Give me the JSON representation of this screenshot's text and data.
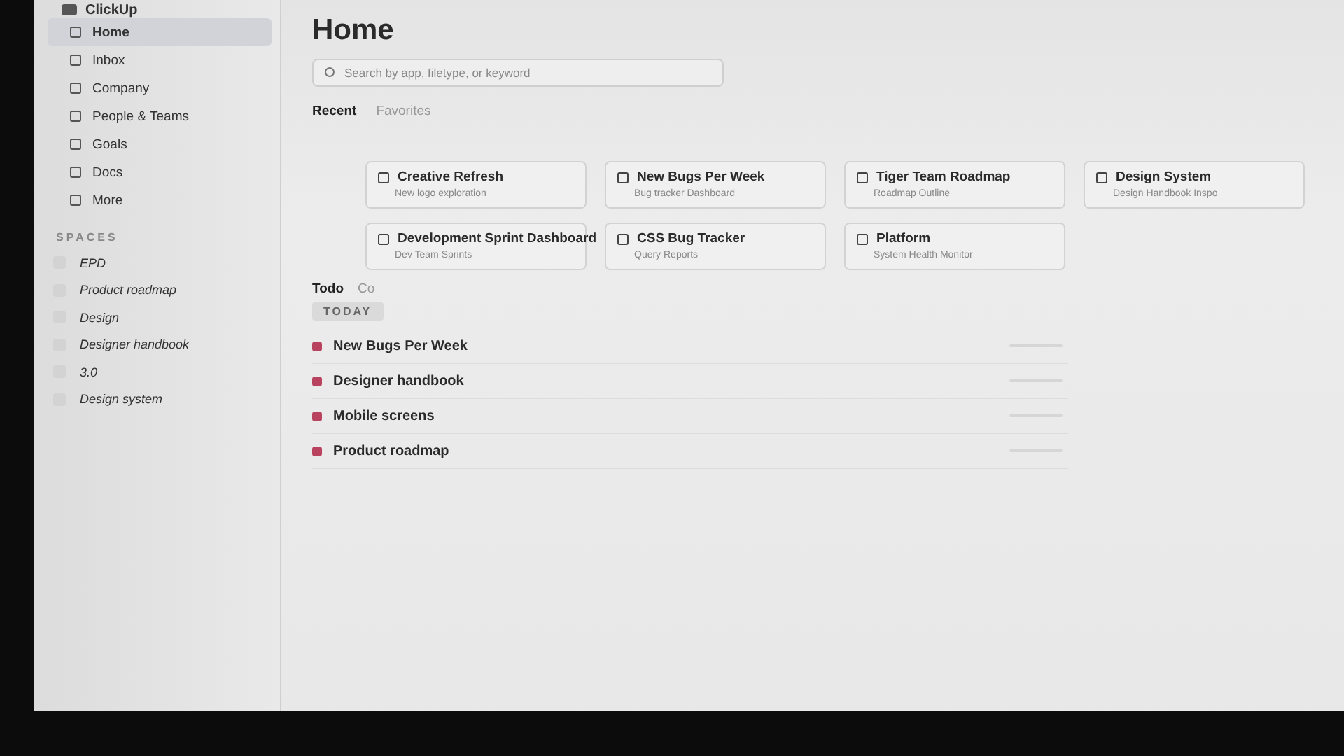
{
  "sidebar": {
    "logo": "ClickUp",
    "items": [
      {
        "label": "Home",
        "selected": true
      },
      {
        "label": "Inbox",
        "selected": false
      },
      {
        "label": "Company",
        "selected": false
      },
      {
        "label": "People & Teams",
        "selected": false
      },
      {
        "label": "Goals",
        "selected": false
      },
      {
        "label": "Docs",
        "selected": false
      },
      {
        "label": "More",
        "selected": false
      }
    ],
    "spaces_heading": "SPACES",
    "spaces": [
      "EPD",
      "Product roadmap",
      "Design",
      "Designer handbook",
      "3.0",
      "Design system"
    ]
  },
  "main": {
    "title": "Home",
    "search": {
      "placeholder": "Search by app, filetype, or keyword"
    },
    "tabs": [
      {
        "label": "Recent",
        "selected": true
      },
      {
        "label": "Favorites",
        "selected": false
      }
    ],
    "cards": [
      {
        "title": "Creative Refresh",
        "subtitle": "New logo exploration"
      },
      {
        "title": "New Bugs Per Week",
        "subtitle": "Bug tracker Dashboard"
      },
      {
        "title": "Tiger Team Roadmap",
        "subtitle": "Roadmap Outline"
      },
      {
        "title": "Design System",
        "subtitle": "Design Handbook Inspo"
      },
      {
        "title": "Development Sprint Dashboard",
        "subtitle": "Dev Team Sprints"
      },
      {
        "title": "CSS Bug Tracker",
        "subtitle": "Query Reports"
      },
      {
        "title": "Platform",
        "subtitle": "System Health Monitor"
      }
    ],
    "todo_tabs": [
      {
        "label": "Todo",
        "selected": true
      },
      {
        "label": "Co",
        "selected": false
      }
    ],
    "group_label": "TODAY",
    "tasks": [
      "New Bugs Per Week",
      "Designer handbook",
      "Mobile screens",
      "Product roadmap"
    ]
  }
}
